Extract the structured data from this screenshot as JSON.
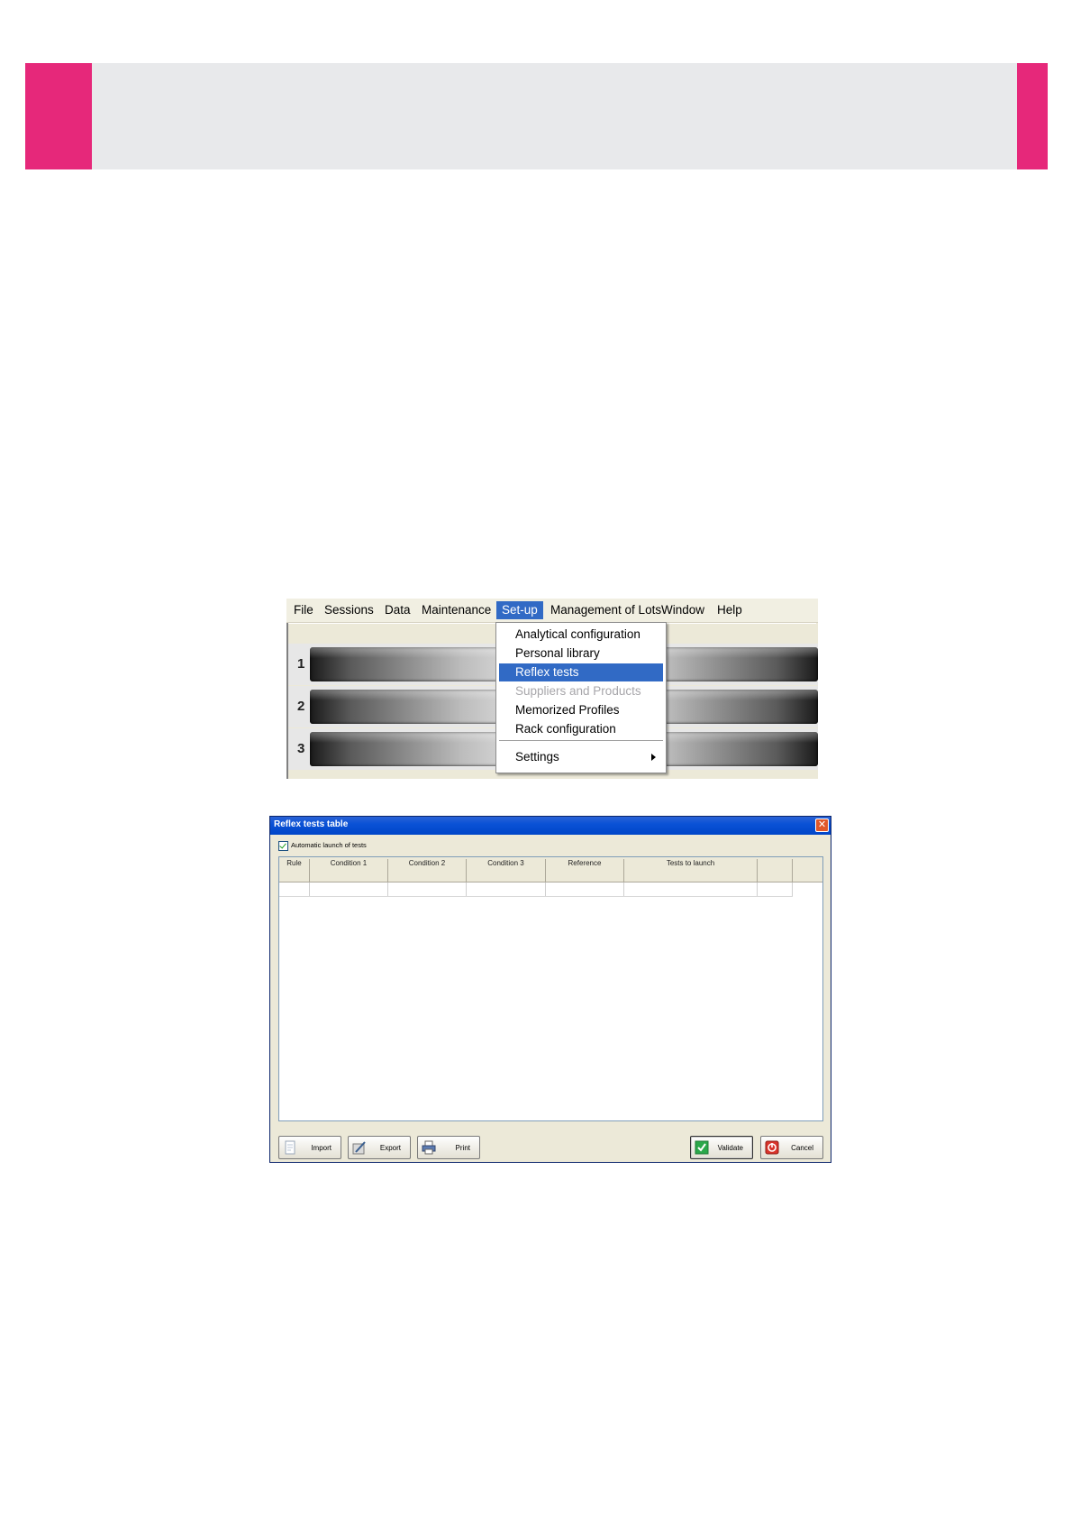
{
  "colors": {
    "accent": "#e6287a",
    "header_bg": "#e8e9eb",
    "menu_highlight": "#316ac5"
  },
  "menu": {
    "items": [
      "File",
      "Sessions",
      "Data",
      "Maintenance",
      "Set-up",
      "Management of Lots",
      "Window",
      "Help"
    ],
    "active": "Set-up",
    "dropdown": [
      "Analytical configuration",
      "Personal library",
      "Reflex tests",
      "Suppliers and Products",
      "Memorized Profiles",
      "Rack configuration",
      "Settings"
    ],
    "highlighted": "Reflex tests",
    "disabled": "Suppliers and Products"
  },
  "rows": [
    "1",
    "2",
    "3"
  ],
  "dialog": {
    "title": "Reflex tests table",
    "close_glyph": "✕",
    "checkbox_label": "Automatic launch of tests",
    "checkbox_checked": true,
    "columns": [
      "Rule",
      "Condition 1",
      "Condition 2",
      "Condition 3",
      "Reference",
      "Tests to launch"
    ],
    "buttons": {
      "import": "Import",
      "export": "Export",
      "print": "Print",
      "validate": "Validate",
      "cancel": "Cancel"
    }
  }
}
